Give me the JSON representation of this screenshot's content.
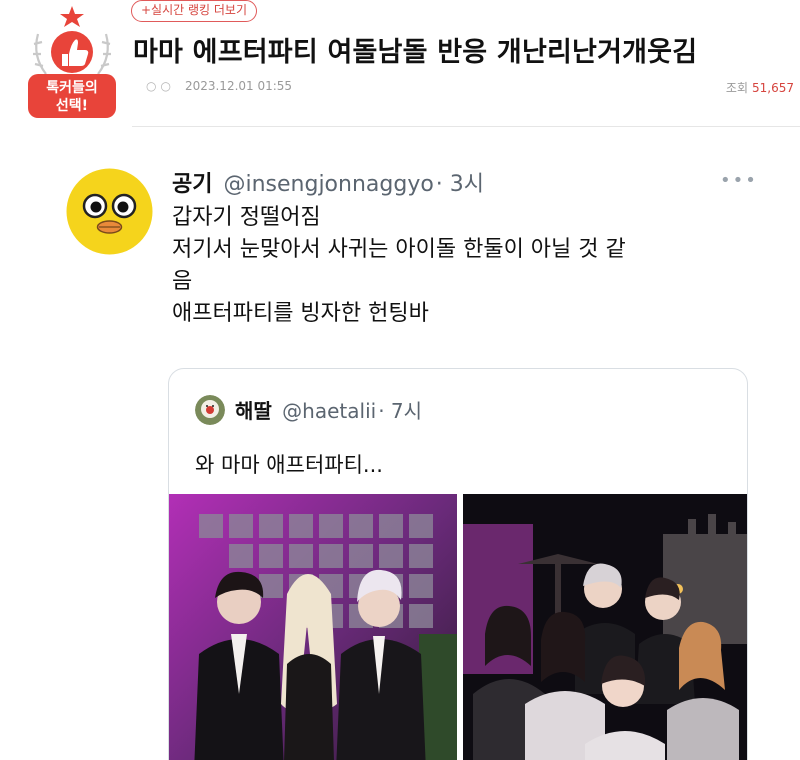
{
  "header": {
    "badge_text_line1": "톡커들의",
    "badge_text_line2": "선택!",
    "rank_link": "+실시간 랭킹 더보기",
    "title": "마마 에프터파티 여돌남돌 반응 개난리난거개웃김",
    "date": "2023.12.01 01:55",
    "views_label": "조회",
    "views_count": "51,657"
  },
  "tweet": {
    "name": "공기",
    "handle": "@insengjonnaggyo",
    "time": "· 3시",
    "lines": [
      "갑자기 정떨어짐",
      "저기서 눈맞아서 사귀는 아이돌 한둘이 아닐 것 같",
      "음",
      "애프터파티를 빙자한 헌팅바"
    ]
  },
  "quote": {
    "name": "해딸",
    "handle": "@haetalii",
    "time": "· 7시",
    "text": "와 마마 애프터파티..."
  },
  "colors": {
    "accent": "#d6453f",
    "badge_red": "#e8443a",
    "muted": "#9a9a9a",
    "avatar_yellow": "#f5d41c"
  }
}
